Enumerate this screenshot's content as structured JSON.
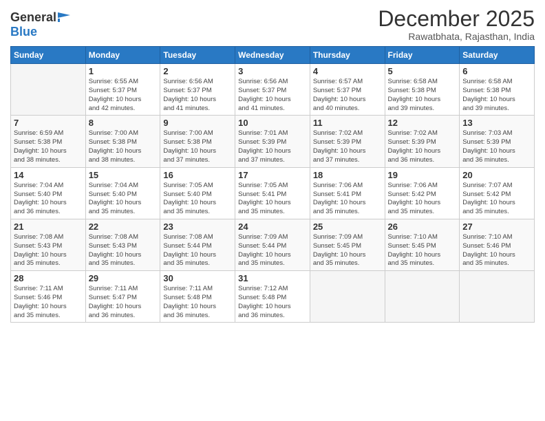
{
  "logo": {
    "general": "General",
    "blue": "Blue"
  },
  "title": "December 2025",
  "location": "Rawatbhata, Rajasthan, India",
  "days_of_week": [
    "Sunday",
    "Monday",
    "Tuesday",
    "Wednesday",
    "Thursday",
    "Friday",
    "Saturday"
  ],
  "weeks": [
    [
      {
        "date": "",
        "info": ""
      },
      {
        "date": "1",
        "info": "Sunrise: 6:55 AM\nSunset: 5:37 PM\nDaylight: 10 hours\nand 42 minutes."
      },
      {
        "date": "2",
        "info": "Sunrise: 6:56 AM\nSunset: 5:37 PM\nDaylight: 10 hours\nand 41 minutes."
      },
      {
        "date": "3",
        "info": "Sunrise: 6:56 AM\nSunset: 5:37 PM\nDaylight: 10 hours\nand 41 minutes."
      },
      {
        "date": "4",
        "info": "Sunrise: 6:57 AM\nSunset: 5:37 PM\nDaylight: 10 hours\nand 40 minutes."
      },
      {
        "date": "5",
        "info": "Sunrise: 6:58 AM\nSunset: 5:38 PM\nDaylight: 10 hours\nand 39 minutes."
      },
      {
        "date": "6",
        "info": "Sunrise: 6:58 AM\nSunset: 5:38 PM\nDaylight: 10 hours\nand 39 minutes."
      }
    ],
    [
      {
        "date": "7",
        "info": "Sunrise: 6:59 AM\nSunset: 5:38 PM\nDaylight: 10 hours\nand 38 minutes."
      },
      {
        "date": "8",
        "info": "Sunrise: 7:00 AM\nSunset: 5:38 PM\nDaylight: 10 hours\nand 38 minutes."
      },
      {
        "date": "9",
        "info": "Sunrise: 7:00 AM\nSunset: 5:38 PM\nDaylight: 10 hours\nand 37 minutes."
      },
      {
        "date": "10",
        "info": "Sunrise: 7:01 AM\nSunset: 5:39 PM\nDaylight: 10 hours\nand 37 minutes."
      },
      {
        "date": "11",
        "info": "Sunrise: 7:02 AM\nSunset: 5:39 PM\nDaylight: 10 hours\nand 37 minutes."
      },
      {
        "date": "12",
        "info": "Sunrise: 7:02 AM\nSunset: 5:39 PM\nDaylight: 10 hours\nand 36 minutes."
      },
      {
        "date": "13",
        "info": "Sunrise: 7:03 AM\nSunset: 5:39 PM\nDaylight: 10 hours\nand 36 minutes."
      }
    ],
    [
      {
        "date": "14",
        "info": "Sunrise: 7:04 AM\nSunset: 5:40 PM\nDaylight: 10 hours\nand 36 minutes."
      },
      {
        "date": "15",
        "info": "Sunrise: 7:04 AM\nSunset: 5:40 PM\nDaylight: 10 hours\nand 35 minutes."
      },
      {
        "date": "16",
        "info": "Sunrise: 7:05 AM\nSunset: 5:40 PM\nDaylight: 10 hours\nand 35 minutes."
      },
      {
        "date": "17",
        "info": "Sunrise: 7:05 AM\nSunset: 5:41 PM\nDaylight: 10 hours\nand 35 minutes."
      },
      {
        "date": "18",
        "info": "Sunrise: 7:06 AM\nSunset: 5:41 PM\nDaylight: 10 hours\nand 35 minutes."
      },
      {
        "date": "19",
        "info": "Sunrise: 7:06 AM\nSunset: 5:42 PM\nDaylight: 10 hours\nand 35 minutes."
      },
      {
        "date": "20",
        "info": "Sunrise: 7:07 AM\nSunset: 5:42 PM\nDaylight: 10 hours\nand 35 minutes."
      }
    ],
    [
      {
        "date": "21",
        "info": "Sunrise: 7:08 AM\nSunset: 5:43 PM\nDaylight: 10 hours\nand 35 minutes."
      },
      {
        "date": "22",
        "info": "Sunrise: 7:08 AM\nSunset: 5:43 PM\nDaylight: 10 hours\nand 35 minutes."
      },
      {
        "date": "23",
        "info": "Sunrise: 7:08 AM\nSunset: 5:44 PM\nDaylight: 10 hours\nand 35 minutes."
      },
      {
        "date": "24",
        "info": "Sunrise: 7:09 AM\nSunset: 5:44 PM\nDaylight: 10 hours\nand 35 minutes."
      },
      {
        "date": "25",
        "info": "Sunrise: 7:09 AM\nSunset: 5:45 PM\nDaylight: 10 hours\nand 35 minutes."
      },
      {
        "date": "26",
        "info": "Sunrise: 7:10 AM\nSunset: 5:45 PM\nDaylight: 10 hours\nand 35 minutes."
      },
      {
        "date": "27",
        "info": "Sunrise: 7:10 AM\nSunset: 5:46 PM\nDaylight: 10 hours\nand 35 minutes."
      }
    ],
    [
      {
        "date": "28",
        "info": "Sunrise: 7:11 AM\nSunset: 5:46 PM\nDaylight: 10 hours\nand 35 minutes."
      },
      {
        "date": "29",
        "info": "Sunrise: 7:11 AM\nSunset: 5:47 PM\nDaylight: 10 hours\nand 36 minutes."
      },
      {
        "date": "30",
        "info": "Sunrise: 7:11 AM\nSunset: 5:48 PM\nDaylight: 10 hours\nand 36 minutes."
      },
      {
        "date": "31",
        "info": "Sunrise: 7:12 AM\nSunset: 5:48 PM\nDaylight: 10 hours\nand 36 minutes."
      },
      {
        "date": "",
        "info": ""
      },
      {
        "date": "",
        "info": ""
      },
      {
        "date": "",
        "info": ""
      }
    ]
  ]
}
